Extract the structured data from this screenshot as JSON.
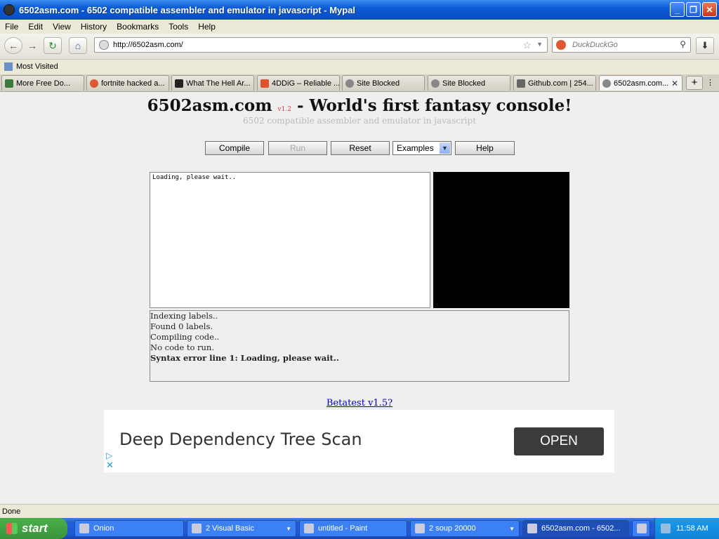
{
  "window": {
    "title": "6502asm.com - 6502 compatible assembler and emulator in javascript - Mypal"
  },
  "menu": [
    "File",
    "Edit",
    "View",
    "History",
    "Bookmarks",
    "Tools",
    "Help"
  ],
  "nav": {
    "url": "http://6502asm.com/",
    "search_placeholder": "DuckDuckGo"
  },
  "bookmarks": {
    "most_visited": "Most Visited"
  },
  "tabs": [
    {
      "label": "More Free Do...",
      "color": "#3d7a3d"
    },
    {
      "label": "fortnite hacked a...",
      "color": "#de5833"
    },
    {
      "label": "What The Hell Ar...",
      "color": "#222222"
    },
    {
      "label": "4DDiG – Reliable ...",
      "color": "#e2502a"
    },
    {
      "label": "Site Blocked",
      "color": "#888888"
    },
    {
      "label": "Site Blocked",
      "color": "#888888"
    },
    {
      "label": "Github.com | 254...",
      "color": "#666666"
    },
    {
      "label": "6502asm.com...",
      "color": "#888888"
    }
  ],
  "page": {
    "site_title": "6502asm.com",
    "version": "v1.2",
    "site_title_rest": " - World's first fantasy console!",
    "subtitle": "6502 compatible assembler and emulator in javascript",
    "buttons": {
      "compile": "Compile",
      "run": "Run",
      "reset": "Reset",
      "examples": "Examples",
      "help": "Help"
    },
    "editor_text": "Loading, please wait..",
    "log": [
      "Indexing labels..",
      "Found 0 labels.",
      "Compiling code..",
      "No code to run."
    ],
    "log_error": "Syntax error line 1: Loading, please wait..",
    "beta_link": "Betatest v1.5?",
    "ad": {
      "text": "Deep Dependency Tree Scan",
      "button": "OPEN"
    }
  },
  "status": "Done",
  "taskbar": {
    "start": "start",
    "tasks": [
      "Onion",
      "2 Visual Basic",
      "untitled - Paint",
      "2 soup 20000",
      "6502asm.com - 6502..."
    ],
    "clock": "11:58 AM"
  }
}
